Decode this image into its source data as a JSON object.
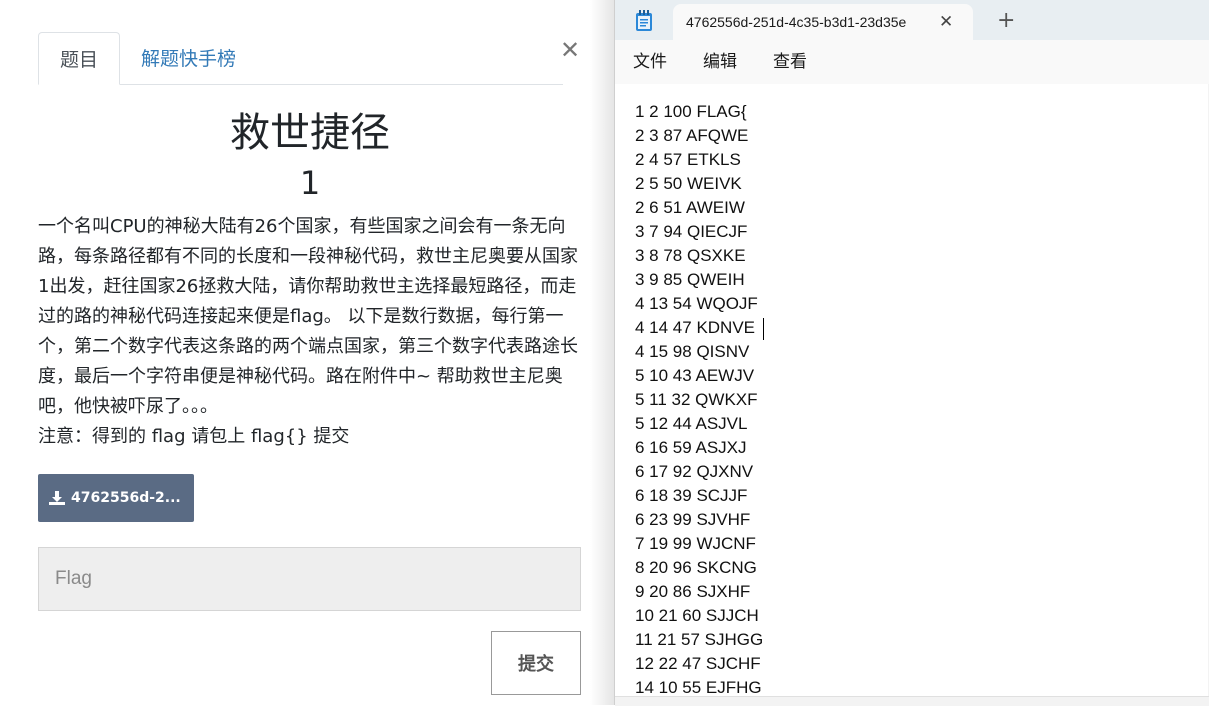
{
  "challenge": {
    "tabs": [
      {
        "label": "题目"
      },
      {
        "label": "解题快手榜"
      }
    ],
    "close_icon": "close-icon",
    "title": "救世捷径",
    "points": "1",
    "description": "一个名叫CPU的神秘大陆有26个国家，有些国家之间会有一条无向路，每条路径都有不同的长度和一段神秘代码，救世主尼奥要从国家1出发，赶往国家26拯救大陆，请你帮助救世主选择最短路径，而走过的路的神秘代码连接起来便是flag。 以下是数行数据，每行第一个，第二个数字代表这条路的两个端点国家，第三个数字代表路途长度，最后一个字符串便是神秘代码。路在附件中~ 帮助救世主尼奥吧，他快被吓尿了。。。",
    "note": "注意：得到的 flag 请包上 flag{} 提交",
    "download": {
      "label": "4762556d-2...",
      "icon": "download-icon"
    },
    "flag_input": {
      "placeholder": "Flag",
      "value": ""
    },
    "submit_label": "提交",
    "colors": {
      "tab_link": "#337ab7",
      "download_bg": "#5a6b84"
    }
  },
  "notepad": {
    "tab_title": "4762556d-251d-4c35-b3d1-23d35e",
    "app_icon": "notepad-icon",
    "menu": [
      {
        "label": "文件"
      },
      {
        "label": "编辑"
      },
      {
        "label": "查看"
      }
    ],
    "lines": [
      "1 2 100 FLAG{",
      "2 3 87 AFQWE",
      "2 4 57 ETKLS",
      "2 5 50 WEIVK",
      "2 6 51 AWEIW",
      "3 7 94 QIECJF",
      "3 8 78 QSXKE",
      "3 9 85 QWEIH",
      "4 13 54 WQOJF",
      "4 14 47 KDNVE",
      "4 15 98 QISNV",
      "5 10 43 AEWJV",
      "5 11 32 QWKXF",
      "5 12 44 ASJVL",
      "6 16 59 ASJXJ",
      "6 17 92 QJXNV",
      "6 18 39 SCJJF",
      "6 23 99 SJVHF",
      "7 19 99 WJCNF",
      "8 20 96 SKCNG",
      "9 20 86 SJXHF",
      "10 21 60 SJJCH",
      "11 21 57 SJHGG",
      "12 22 47 SJCHF",
      "14 10 55 EJFHG"
    ]
  }
}
